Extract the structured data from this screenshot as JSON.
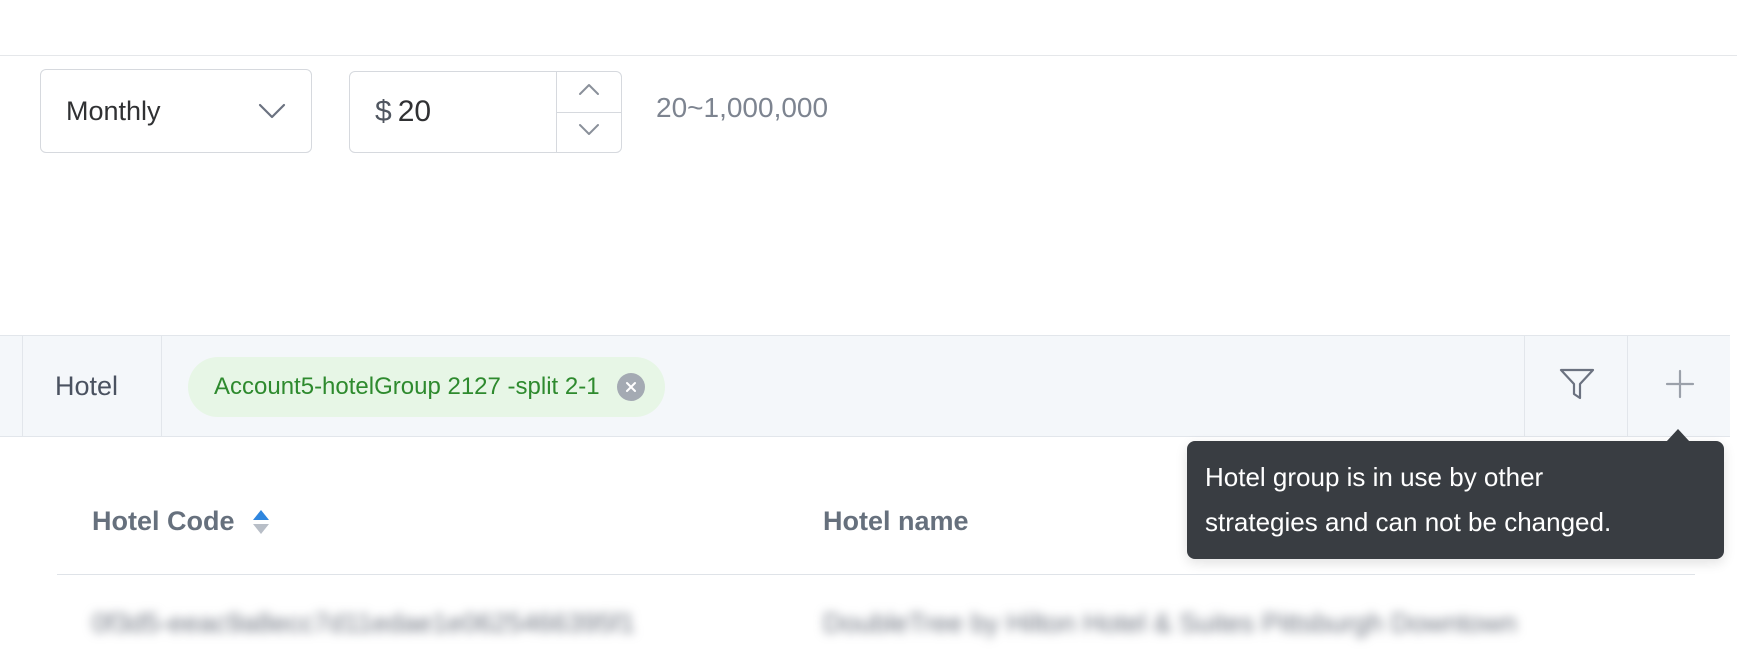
{
  "budget": {
    "period_select": {
      "value": "Monthly",
      "icon": "chevron-down-icon"
    },
    "amount": {
      "currency": "$",
      "value": "20",
      "up_icon": "chevron-up-icon",
      "down_icon": "chevron-down-icon"
    },
    "range_hint": "20~1,000,000"
  },
  "hotel_filter": {
    "label": "Hotel",
    "tag": {
      "text": "Account5-hotelGroup 2127 -split 2-1",
      "close_icon": "close-circle-icon"
    },
    "filter_icon": "filter-icon",
    "add_icon": "plus-icon"
  },
  "tooltip": {
    "line1": "Hotel group is in use by other",
    "line2": "strategies and can not be changed."
  },
  "table": {
    "columns": [
      "Hotel Code",
      "Hotel name"
    ],
    "sort_icon": "sort-icon",
    "rows": [
      {
        "code": "0f3d5-eeac9a8ecc7d11edae1e0625466395f1",
        "name": "DoubleTree by Hilton Hotel & Suites Pittsburgh Downtown"
      }
    ]
  },
  "colors": {
    "tag_bg": "#e7f6e6",
    "tag_text": "#2e8a2e",
    "tooltip_bg": "#393d42",
    "sort_active": "#2f86de"
  }
}
